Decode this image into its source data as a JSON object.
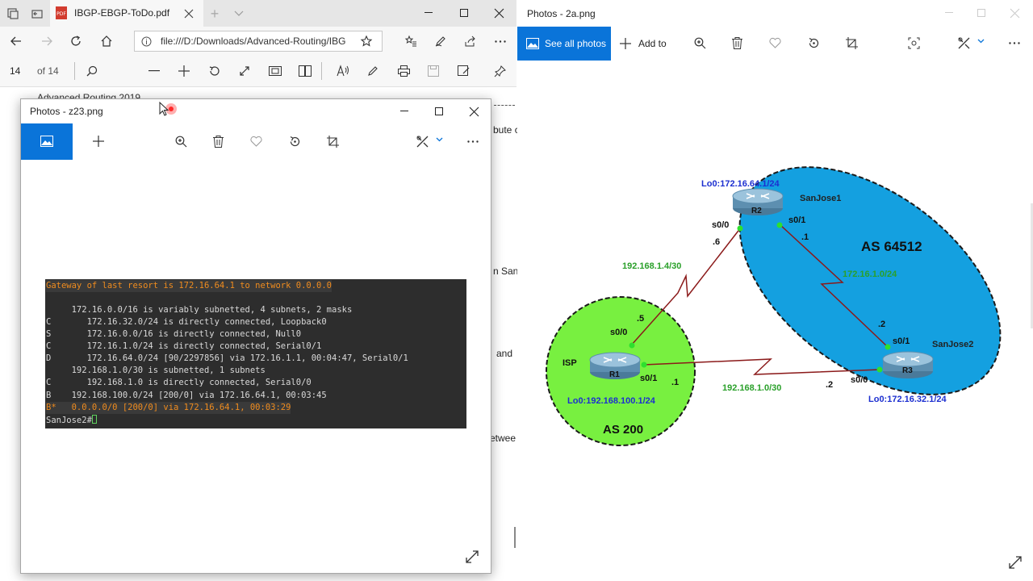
{
  "edge": {
    "tab_title": "IBGP-EBGP-ToDo.pdf",
    "address": "file:///D:/Downloads/Advanced-Routing/IBG",
    "pdf": {
      "page_number": "14",
      "page_total": "of 14",
      "doc_heading": "Advanced Routing 2019",
      "snippets": [
        "bute c",
        "n San",
        "and",
        "etwee"
      ]
    }
  },
  "photos_z23": {
    "title": "Photos - z23.png",
    "terminal_lines": [
      "Gateway of last resort is 172.16.64.1 to network 0.0.0.0",
      "",
      "     172.16.0.0/16 is variably subnetted, 4 subnets, 2 masks",
      "C       172.16.32.0/24 is directly connected, Loopback0",
      "S       172.16.0.0/16 is directly connected, Null0",
      "C       172.16.1.0/24 is directly connected, Serial0/1",
      "D       172.16.64.0/24 [90/2297856] via 172.16.1.1, 00:04:47, Serial0/1",
      "     192.168.1.0/30 is subnetted, 1 subnets",
      "C       192.168.1.0 is directly connected, Serial0/0",
      "B    192.168.100.0/24 [200/0] via 172.16.64.1, 00:03:45",
      "B*   0.0.0.0/0 [200/0] via 172.16.64.1, 00:03:29",
      "SanJose2#"
    ]
  },
  "photos_2a": {
    "title": "Photos - 2a.png",
    "see_all_label": "See all photos",
    "add_to_label": "Add to",
    "diagram": {
      "as_64512": "AS 64512",
      "as_200": "AS 200",
      "r1": "R1",
      "r2": "R2",
      "r3": "R3",
      "isp": "ISP",
      "sanjose1": "SanJose1",
      "sanjose2": "SanJose2",
      "r2_lo0": "Lo0:172.16.64.1/24",
      "r1_lo0": "Lo0:192.168.100.1/24",
      "r3_lo0": "Lo0:172.16.32.1/24",
      "net_r1_r2": "192.168.1.4/30",
      "net_r1_r3": "192.168.1.0/30",
      "net_r2_r3": "172.16.1.0/24",
      "r2_s00": "s0/0",
      "r2_s00_host": ".6",
      "r2_s01": "s0/1",
      "r2_s01_host": ".1",
      "r3_s01": "s0/1",
      "r3_s01_host": ".2",
      "r3_s00": "s0/0",
      "r3_s00_host": ".2",
      "r1_s00": "s0/0",
      "r1_s00_host": ".5",
      "r1_s01": "s0/1",
      "r1_s01_host": ".1"
    }
  },
  "colors": {
    "accent_blue": "#0a74d9",
    "as64512_fill": "#14a0e0",
    "as200_fill": "#78f040",
    "link_red": "#8b1a1a",
    "label_green": "#2aa02a",
    "label_blue": "#1c2fd0"
  }
}
